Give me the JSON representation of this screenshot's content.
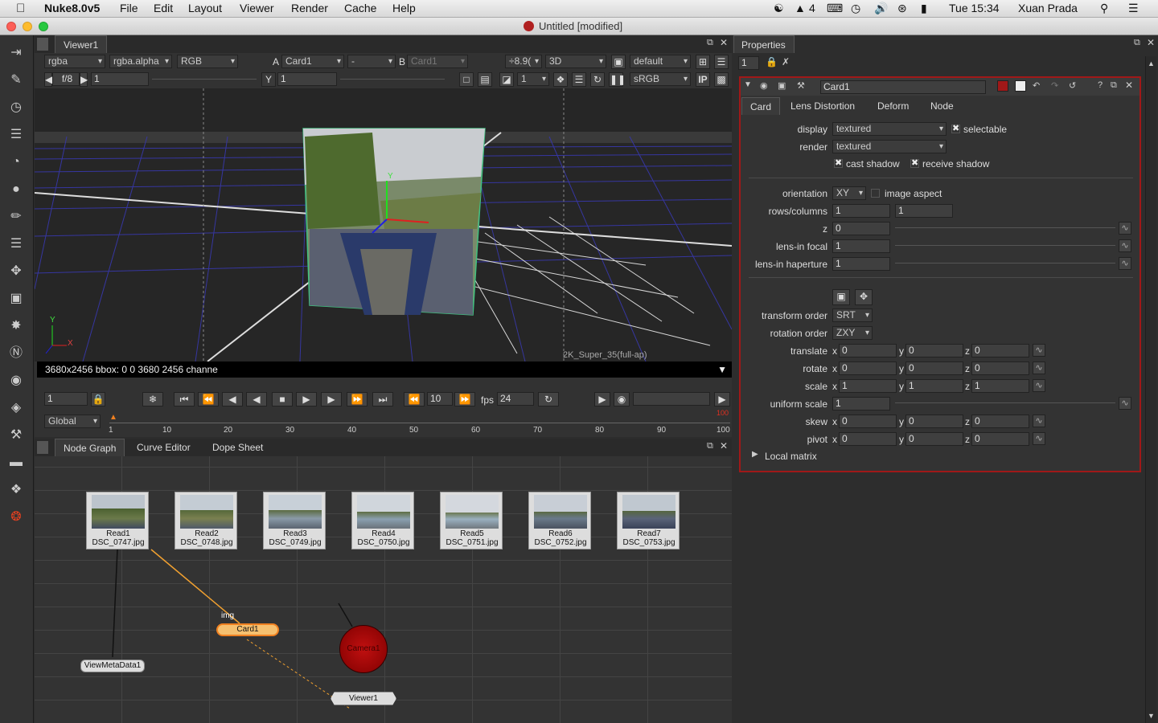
{
  "menubar": {
    "app": "Nuke8.0v5",
    "items": [
      "File",
      "Edit",
      "Layout",
      "Viewer",
      "Render",
      "Cache",
      "Help"
    ],
    "status_num": "4",
    "clock": "Tue 15:34",
    "user": "Xuan Prada"
  },
  "window": {
    "title": "Untitled [modified]"
  },
  "viewer": {
    "tab": "Viewer1",
    "channels": "rgba",
    "alpha": "rgba.alpha",
    "display": "RGB",
    "a_label": "A",
    "a_input": "Card1",
    "dash": "-",
    "b_label": "B",
    "b_input": "Card1",
    "gain": "÷8.9(",
    "view_mode": "3D",
    "camera": "default",
    "fstop": "f/8",
    "frame": "1",
    "y_label": "Y",
    "y_value": "1",
    "downrez": "1",
    "lut": "sRGB",
    "ip": "IP",
    "format_label": "2K_Super_35(full-ap)",
    "info": "3680x2456 bbox: 0 0 3680 2456 channe"
  },
  "timeline": {
    "start_frame": "1",
    "frame": "10",
    "fps_label": "fps",
    "fps": "24",
    "scope": "Global",
    "end_marker": "100",
    "ticks": [
      "1",
      "10",
      "20",
      "30",
      "40",
      "50",
      "60",
      "70",
      "80",
      "90",
      "100"
    ]
  },
  "nodegraph": {
    "tabs": [
      "Node Graph",
      "Curve Editor",
      "Dope Sheet"
    ],
    "reads": [
      {
        "name": "Read1",
        "file": "DSC_0747.jpg"
      },
      {
        "name": "Read2",
        "file": "DSC_0748.jpg"
      },
      {
        "name": "Read3",
        "file": "DSC_0749.jpg"
      },
      {
        "name": "Read4",
        "file": "DSC_0750.jpg"
      },
      {
        "name": "Read5",
        "file": "DSC_0751.jpg"
      },
      {
        "name": "Read6",
        "file": "DSC_0752.jpg"
      },
      {
        "name": "Read7",
        "file": "DSC_0753.jpg"
      }
    ],
    "viewmeta": "ViewMetaData1",
    "img_label": "img",
    "card": "Card1",
    "camera": "Camera1",
    "viewer": "Viewer1"
  },
  "properties": {
    "tab": "Properties",
    "max_panels": "1",
    "node_name": "Card1",
    "node_tabs": [
      "Card",
      "Lens Distortion",
      "Deform",
      "Node"
    ],
    "display_label": "display",
    "display": "textured",
    "selectable": "selectable",
    "render_label": "render",
    "render": "textured",
    "cast_shadow": "cast shadow",
    "receive_shadow": "receive shadow",
    "orientation_label": "orientation",
    "orientation": "XY",
    "image_aspect": "image aspect",
    "rows_label": "rows/columns",
    "rows": "1",
    "columns": "1",
    "z_label": "z",
    "z": "0",
    "focal_label": "lens-in focal",
    "focal": "1",
    "haperture_label": "lens-in haperture",
    "haperture": "1",
    "transform_order_label": "transform order",
    "transform_order": "SRT",
    "rotation_order_label": "rotation order",
    "rotation_order": "ZXY",
    "xyz_labels": [
      "x",
      "y",
      "z"
    ],
    "translate_label": "translate",
    "translate": [
      "0",
      "0",
      "0"
    ],
    "rotate_label": "rotate",
    "rotate": [
      "0",
      "0",
      "0"
    ],
    "scale_label": "scale",
    "scale": [
      "1",
      "1",
      "1"
    ],
    "uniform_scale_label": "uniform scale",
    "uniform_scale": "1",
    "skew_label": "skew",
    "skew": [
      "0",
      "0",
      "0"
    ],
    "pivot_label": "pivot",
    "pivot": [
      "0",
      "0",
      "0"
    ],
    "local_matrix": "Local matrix"
  },
  "accent": "#f0a030"
}
